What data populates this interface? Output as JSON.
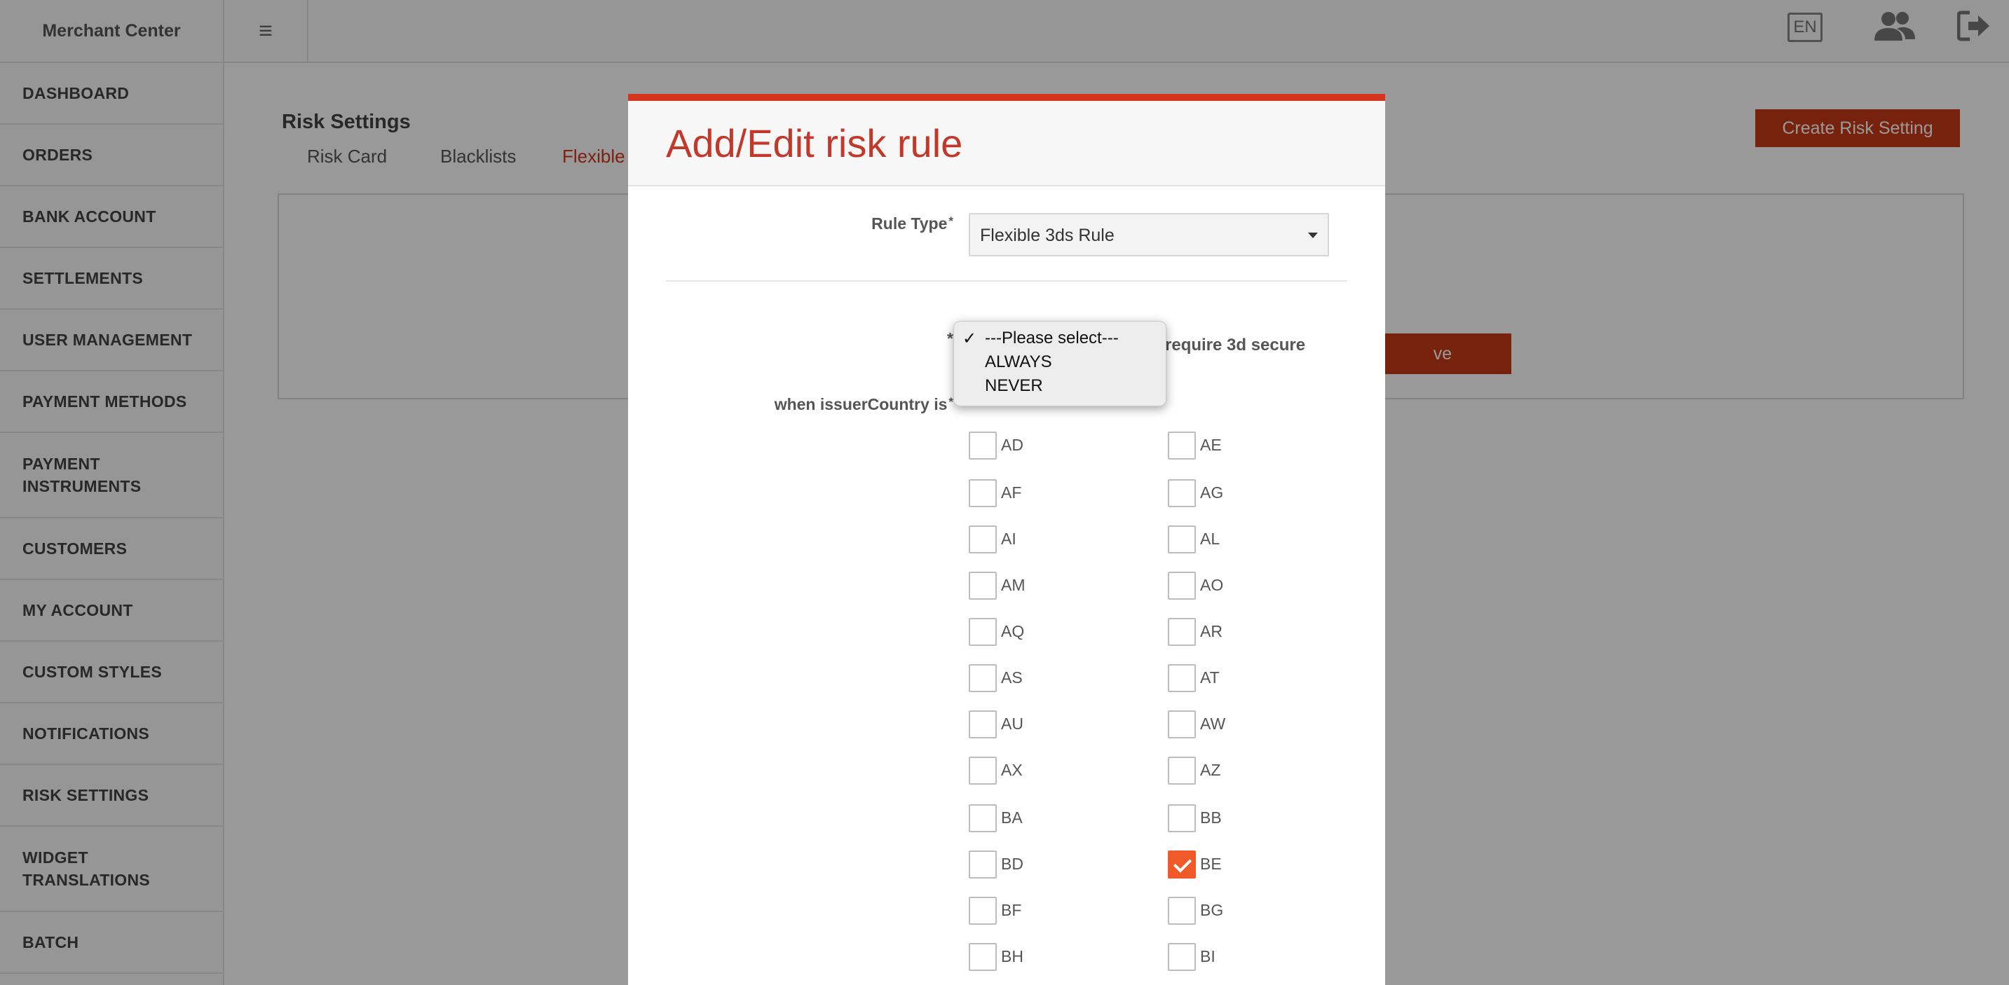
{
  "topbar": {
    "brand": "Merchant Center",
    "menu_icon": "hamburger-icon",
    "language": "EN",
    "users_icon": "users-icon",
    "logout_icon": "logout-icon"
  },
  "sidebar": {
    "items": [
      {
        "label": "DASHBOARD"
      },
      {
        "label": "ORDERS"
      },
      {
        "label": "BANK ACCOUNT"
      },
      {
        "label": "SETTLEMENTS"
      },
      {
        "label": "USER MANAGEMENT"
      },
      {
        "label": "PAYMENT METHODS"
      },
      {
        "label": "PAYMENT\nINSTRUMENTS"
      },
      {
        "label": "CUSTOMERS"
      },
      {
        "label": "MY ACCOUNT"
      },
      {
        "label": "CUSTOM STYLES"
      },
      {
        "label": "NOTIFICATIONS"
      },
      {
        "label": "RISK SETTINGS"
      },
      {
        "label": "WIDGET\nTRANSLATIONS"
      },
      {
        "label": "BATCH"
      }
    ]
  },
  "page": {
    "title": "Risk Settings",
    "tabs": [
      {
        "label": "Risk Card"
      },
      {
        "label": "Blacklists"
      },
      {
        "label": "Flexible"
      }
    ],
    "create_button": "Create Risk Setting",
    "panel_button": "ve"
  },
  "modal": {
    "title": "Add/Edit risk rule",
    "rule_type_label": "Rule Type",
    "rule_type_value": "Flexible 3ds Rule",
    "required_mark": "*",
    "require_text": "require 3d secure",
    "when_label": "when issuerCountry is",
    "countries": [
      {
        "code": "AD",
        "checked": false
      },
      {
        "code": "AE",
        "checked": false
      },
      {
        "code": "AF",
        "checked": false
      },
      {
        "code": "AG",
        "checked": false
      },
      {
        "code": "AI",
        "checked": false
      },
      {
        "code": "AL",
        "checked": false
      },
      {
        "code": "AM",
        "checked": false
      },
      {
        "code": "AO",
        "checked": false
      },
      {
        "code": "AQ",
        "checked": false
      },
      {
        "code": "AR",
        "checked": false
      },
      {
        "code": "AS",
        "checked": false
      },
      {
        "code": "AT",
        "checked": false
      },
      {
        "code": "AU",
        "checked": false
      },
      {
        "code": "AW",
        "checked": false
      },
      {
        "code": "AX",
        "checked": false
      },
      {
        "code": "AZ",
        "checked": false
      },
      {
        "code": "BA",
        "checked": false
      },
      {
        "code": "BB",
        "checked": false
      },
      {
        "code": "BD",
        "checked": false
      },
      {
        "code": "BE",
        "checked": true
      },
      {
        "code": "BF",
        "checked": false
      },
      {
        "code": "BG",
        "checked": false
      },
      {
        "code": "BH",
        "checked": false
      },
      {
        "code": "BI",
        "checked": false
      }
    ]
  },
  "dropdown": {
    "check_mark": "✓",
    "options": [
      "---Please select---",
      "ALWAYS",
      "NEVER"
    ],
    "selected": "---Please select---"
  }
}
